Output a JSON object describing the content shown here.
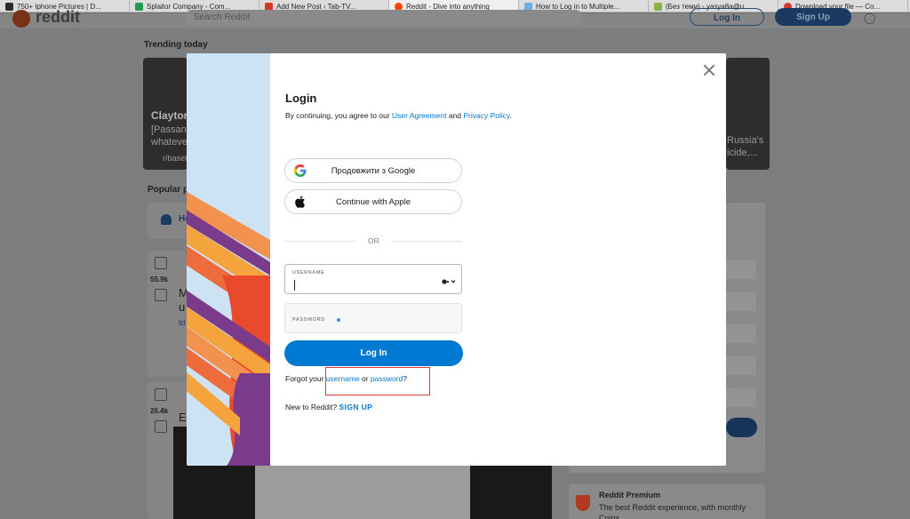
{
  "browser": {
    "tabs": [
      {
        "title": "750+ Iphone Pictures | D...",
        "favicon_color": "#2b2b2b"
      },
      {
        "title": "Splaitor Company - Com...",
        "favicon_color": "#1e9e4a"
      },
      {
        "title": "Add New Post ‹ Tab-TV...",
        "favicon_color": "#d33a2a"
      },
      {
        "title": "Reddit - Dive into anything",
        "favicon_color": "#ff4500",
        "active": true
      },
      {
        "title": "How to Log in to Multiple...",
        "favicon_color": "#6ab0e6"
      },
      {
        "title": "(Без теми) - yasya8a@u...",
        "favicon_color": "#8ab04a"
      },
      {
        "title": "Download your file — Co...",
        "favicon_color": "#d33a2a"
      }
    ]
  },
  "background": {
    "search_placeholder": "Search Reddit",
    "login_label": "Log In",
    "signup_label": "Sign Up",
    "trending_title": "Trending today",
    "trend_card_1": {
      "title": "Claytor",
      "line1": "[Passan]",
      "line2": "whatever",
      "sub": "r/baseb"
    },
    "trend_card_2": {
      "line1": "Russia's",
      "line2": "icide,..."
    },
    "popular_title": "Popular p",
    "home_label": "Ho",
    "post1": {
      "votes": "55.9k",
      "text1": "M",
      "text2": "u",
      "link": "td"
    },
    "post2": {
      "votes": "26.4k",
      "text1": "E"
    },
    "premium": {
      "title": "Reddit Premium",
      "text": "The best Reddit experience, with monthly Coins"
    }
  },
  "modal": {
    "title": "Login",
    "agree_prefix": "By continuing, you agree to our ",
    "user_agreement": "User Agreement",
    "agree_and": " and ",
    "privacy_policy": "Privacy Policy",
    "agree_suffix": ".",
    "google_label": "Продовжити з Google",
    "apple_label": "Continue with Apple",
    "or_label": "OR",
    "username_label": "USERNAME",
    "password_label": "PASSWORD",
    "login_button": "Log In",
    "forgot_prefix": "Forgot your ",
    "forgot_username": "username",
    "forgot_or": " or ",
    "forgot_password": "password",
    "forgot_suffix": "?",
    "new_prefix": "New to Reddit? ",
    "signup_link": "SIGN UP"
  },
  "colors": {
    "accent": "#0079d3",
    "highlight_box": "#e03b3b",
    "art_background": "#cde3f4"
  }
}
